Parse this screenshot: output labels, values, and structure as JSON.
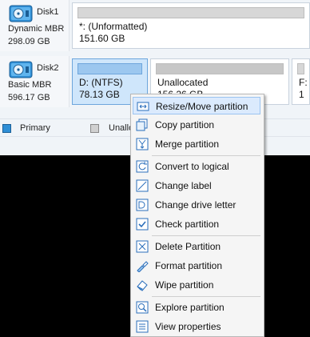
{
  "disks": [
    {
      "name": "Disk1",
      "type": "Dynamic MBR",
      "size": "298.09 GB",
      "partitions": [
        {
          "name": "*: (Unformatted)",
          "size": "151.60 GB"
        }
      ]
    },
    {
      "name": "Disk2",
      "type": "Basic MBR",
      "size": "596.17 GB",
      "partitions": [
        {
          "name": "D: (NTFS)",
          "size": "78.13 GB"
        },
        {
          "name": "Unallocated",
          "size": "156.26 GB"
        },
        {
          "name": "F:",
          "size": "1"
        }
      ]
    }
  ],
  "legend": [
    "Primary",
    "Unallo"
  ],
  "context_menu": {
    "items": [
      {
        "label": "Resize/Move partition",
        "icon": "resize-icon"
      },
      {
        "label": "Copy partition",
        "icon": "copy-icon"
      },
      {
        "label": "Merge partition",
        "icon": "merge-icon"
      },
      {
        "label": "Convert to logical",
        "icon": "convert-icon"
      },
      {
        "label": "Change label",
        "icon": "label-icon"
      },
      {
        "label": "Change drive letter",
        "icon": "drive-letter-icon"
      },
      {
        "label": "Check partition",
        "icon": "check-icon"
      },
      {
        "label": "Delete Partition",
        "icon": "delete-icon"
      },
      {
        "label": "Format partition",
        "icon": "format-icon"
      },
      {
        "label": "Wipe partition",
        "icon": "wipe-icon"
      },
      {
        "label": "Explore partition",
        "icon": "explore-icon"
      },
      {
        "label": "View properties",
        "icon": "properties-icon"
      }
    ]
  }
}
